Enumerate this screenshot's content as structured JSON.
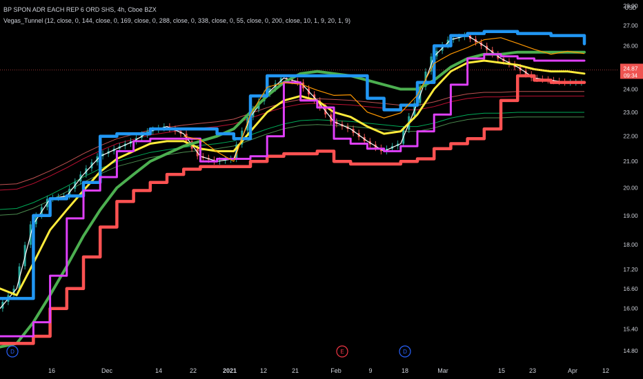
{
  "header": {
    "title": "BP SPON ADR EACH REP 6 ORD SHS, 4h, Cboe BZX",
    "indicator": "Vegas_Tunnel (12, close, 0, 144, close, 0, 169, close, 0, 288, close, 0, 338, close, 0, 55, close, 0, 200, close, 10, 1, 9, 20, 1, 9)"
  },
  "price_scale": {
    "currency": "USD",
    "ticks": [
      "28.00",
      "27.00",
      "26.00",
      "25.00",
      "24.00",
      "23.00",
      "22.00",
      "21.00",
      "20.00",
      "19.00",
      "18.00",
      "17.20",
      "16.60",
      "16.00",
      "15.40",
      "14.80"
    ],
    "last_price": "24.87",
    "countdown": "09:34"
  },
  "time_axis": {
    "ticks": [
      "16",
      "Dec",
      "14",
      "22",
      "2021",
      "12",
      "21",
      "Feb",
      "9",
      "18",
      "Mar",
      "15",
      "23",
      "Apr",
      "12"
    ]
  },
  "events": [
    {
      "label": "D",
      "color": "#2962ff"
    },
    {
      "label": "E",
      "color": "#f23645"
    },
    {
      "label": "D",
      "color": "#2962ff"
    }
  ],
  "colors": {
    "background": "#000000",
    "candle_up": "#26a69a",
    "candle_down": "#ef5350",
    "blue": "#2196f3",
    "green": "#4caf50",
    "yellow": "#ffeb3b",
    "magenta": "#e040fb",
    "orange": "#ff9800",
    "red": "#ff5252"
  },
  "chart_data": {
    "type": "line",
    "x": [
      "Nov 09",
      "Nov 12",
      "Nov 16",
      "Nov 19",
      "Nov 23",
      "Nov 26",
      "Dec 01",
      "Dec 04",
      "Dec 08",
      "Dec 11",
      "Dec 14",
      "Dec 17",
      "Dec 22",
      "Dec 28",
      "Jan 04",
      "Jan 08",
      "Jan 12",
      "Jan 15",
      "Jan 21",
      "Jan 26",
      "Feb 01",
      "Feb 04",
      "Feb 09",
      "Feb 12",
      "Feb 18",
      "Feb 23",
      "Mar 01",
      "Mar 04",
      "Mar 09",
      "Mar 12",
      "Mar 15",
      "Mar 18",
      "Mar 23",
      "Mar 26",
      "Mar 31",
      "Apr 05"
    ],
    "series": [
      {
        "name": "",
        "color": "#ffffff",
        "values": [
          16.0,
          16.6,
          18.7,
          19.6,
          19.7,
          20.5,
          21.2,
          21.5,
          21.8,
          22.2,
          22.4,
          22.1,
          21.2,
          21.0,
          21.1,
          22.8,
          23.8,
          24.5,
          24.3,
          23.5,
          22.6,
          22.3,
          21.8,
          21.4,
          21.7,
          23.4,
          25.5,
          26.3,
          26.5,
          26.0,
          25.4,
          25.0,
          24.5,
          24.4,
          24.3,
          24.3
        ]
      },
      {
        "name": "",
        "color": "#ffeb3b",
        "values": [
          16.6,
          16.4,
          17.4,
          18.5,
          19.2,
          19.9,
          20.6,
          21.1,
          21.4,
          21.7,
          21.8,
          21.8,
          21.5,
          21.4,
          21.4,
          22.2,
          23.0,
          23.5,
          23.7,
          23.5,
          23.0,
          22.8,
          22.4,
          22.1,
          22.2,
          22.9,
          24.0,
          24.8,
          25.2,
          25.3,
          25.2,
          25.1,
          24.9,
          24.8,
          24.8,
          24.7
        ]
      },
      {
        "name": "",
        "color": "#4caf50",
        "values": [
          14.9,
          15.0,
          15.6,
          16.4,
          17.3,
          18.3,
          19.2,
          20.0,
          20.5,
          21.0,
          21.3,
          21.6,
          21.8,
          22.0,
          22.3,
          23.0,
          23.7,
          24.3,
          24.7,
          24.8,
          24.7,
          24.6,
          24.4,
          24.2,
          24.0,
          24.0,
          24.4,
          25.0,
          25.4,
          25.6,
          25.6,
          25.7,
          25.7,
          25.7,
          25.7,
          25.7
        ]
      },
      {
        "name": "",
        "color": "#ff5252",
        "values": [
          15.0,
          15.0,
          15.2,
          16.0,
          16.6,
          17.6,
          18.6,
          19.5,
          19.9,
          20.2,
          20.5,
          20.7,
          20.8,
          20.8,
          20.8,
          21.0,
          21.2,
          21.3,
          21.3,
          21.4,
          21.0,
          20.9,
          20.9,
          20.9,
          21.0,
          21.1,
          21.5,
          21.7,
          21.9,
          22.3,
          23.5,
          24.6,
          24.4,
          24.3,
          24.3,
          24.3
        ]
      },
      {
        "name": "",
        "color": "#2196f3",
        "values": [
          16.3,
          16.3,
          19.0,
          19.6,
          19.7,
          20.2,
          22.0,
          22.1,
          22.1,
          22.3,
          22.3,
          22.3,
          22.3,
          22.1,
          21.9,
          23.7,
          24.6,
          24.6,
          24.6,
          24.6,
          24.6,
          24.6,
          23.6,
          23.1,
          23.3,
          24.3,
          26.0,
          26.5,
          26.6,
          26.7,
          26.7,
          26.6,
          26.6,
          26.5,
          26.5,
          26.1
        ]
      },
      {
        "name": "",
        "color": "#e040fb",
        "values": [
          15.2,
          15.2,
          15.6,
          17.0,
          18.9,
          19.9,
          20.4,
          21.4,
          21.8,
          21.9,
          21.9,
          21.9,
          21.0,
          21.1,
          21.1,
          21.2,
          22.0,
          24.3,
          23.5,
          23.2,
          21.9,
          21.7,
          21.5,
          21.4,
          21.6,
          22.2,
          22.9,
          24.2,
          25.4,
          25.6,
          25.5,
          25.4,
          25.3,
          25.3,
          25.3,
          25.3
        ]
      }
    ],
    "xlabel": "",
    "ylabel": "",
    "yscale": "log",
    "ylim": [
      14.5,
      28.3
    ]
  }
}
